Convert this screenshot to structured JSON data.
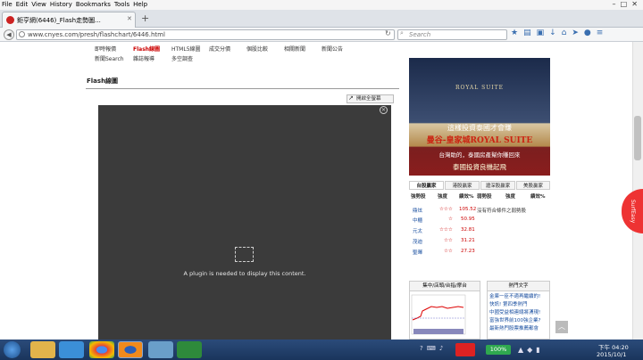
{
  "menubar": {
    "items": [
      "File",
      "Edit",
      "View",
      "History",
      "Bookmarks",
      "Tools",
      "Help"
    ]
  },
  "tab": {
    "title": "鉅亨網(6446)_Flash走勢圖..."
  },
  "url": {
    "value": "www.cnyes.com/presh/flashchart/6446.html"
  },
  "search": {
    "placeholder": "Search"
  },
  "nav_links": {
    "row1": [
      "即時報價",
      "Flash線圖",
      "HTML5線圖",
      "成交分價",
      "個股比較",
      "相關新聞",
      "新聞公告"
    ],
    "row2": [
      "新聞Search",
      "雜誌報導",
      "多空調查"
    ]
  },
  "flash_tab": "Flash線圖",
  "full_button": "開啟全螢幕",
  "plugin_message": "A plugin is needed to display this content.",
  "ad": {
    "brand": "ROYAL SUITE",
    "line1": "這樣投資泰國才會賺",
    "line2": "曼谷-皇家城ROYAL SUITE",
    "line3": "台灣助的，泰國房產幫你賺回來",
    "line4": "泰國投資良機起飛"
  },
  "market_tabs": [
    "台股贏家",
    "港股贏家",
    "滬深股贏家",
    "美股贏家"
  ],
  "stock_table": {
    "headers": [
      "強勢股",
      "強度",
      "績效%",
      "弱勢股",
      "強度",
      "績效%"
    ],
    "weak_note": "沒有符合條件之弱勢股",
    "rows": [
      {
        "name": "鼎炫",
        "stars": "☆☆☆",
        "perf": "105.52"
      },
      {
        "name": "中櫃",
        "stars": "☆",
        "perf": "50.95"
      },
      {
        "name": "元太",
        "stars": "☆☆☆",
        "perf": "32.81"
      },
      {
        "name": "茂迪",
        "stars": "☆☆",
        "perf": "31.21"
      },
      {
        "name": "聖暉",
        "stars": "☆☆",
        "perf": "27.23"
      }
    ]
  },
  "chart_box": {
    "title": "集中/店頭/台指/摩台"
  },
  "hot_news": {
    "title": "熱門文字",
    "items": [
      "金庫一臣不適再繼續的!",
      "快訊! 第四季熱門",
      "中國受益相連總將湧現!",
      "富強世界前100強企業?",
      "最新熱門股票推薦都會"
    ]
  },
  "taskbar": {
    "time": "下午 04:20",
    "date": "2015/10/1",
    "zoom": "100%"
  },
  "surfly": "SurfEasy"
}
